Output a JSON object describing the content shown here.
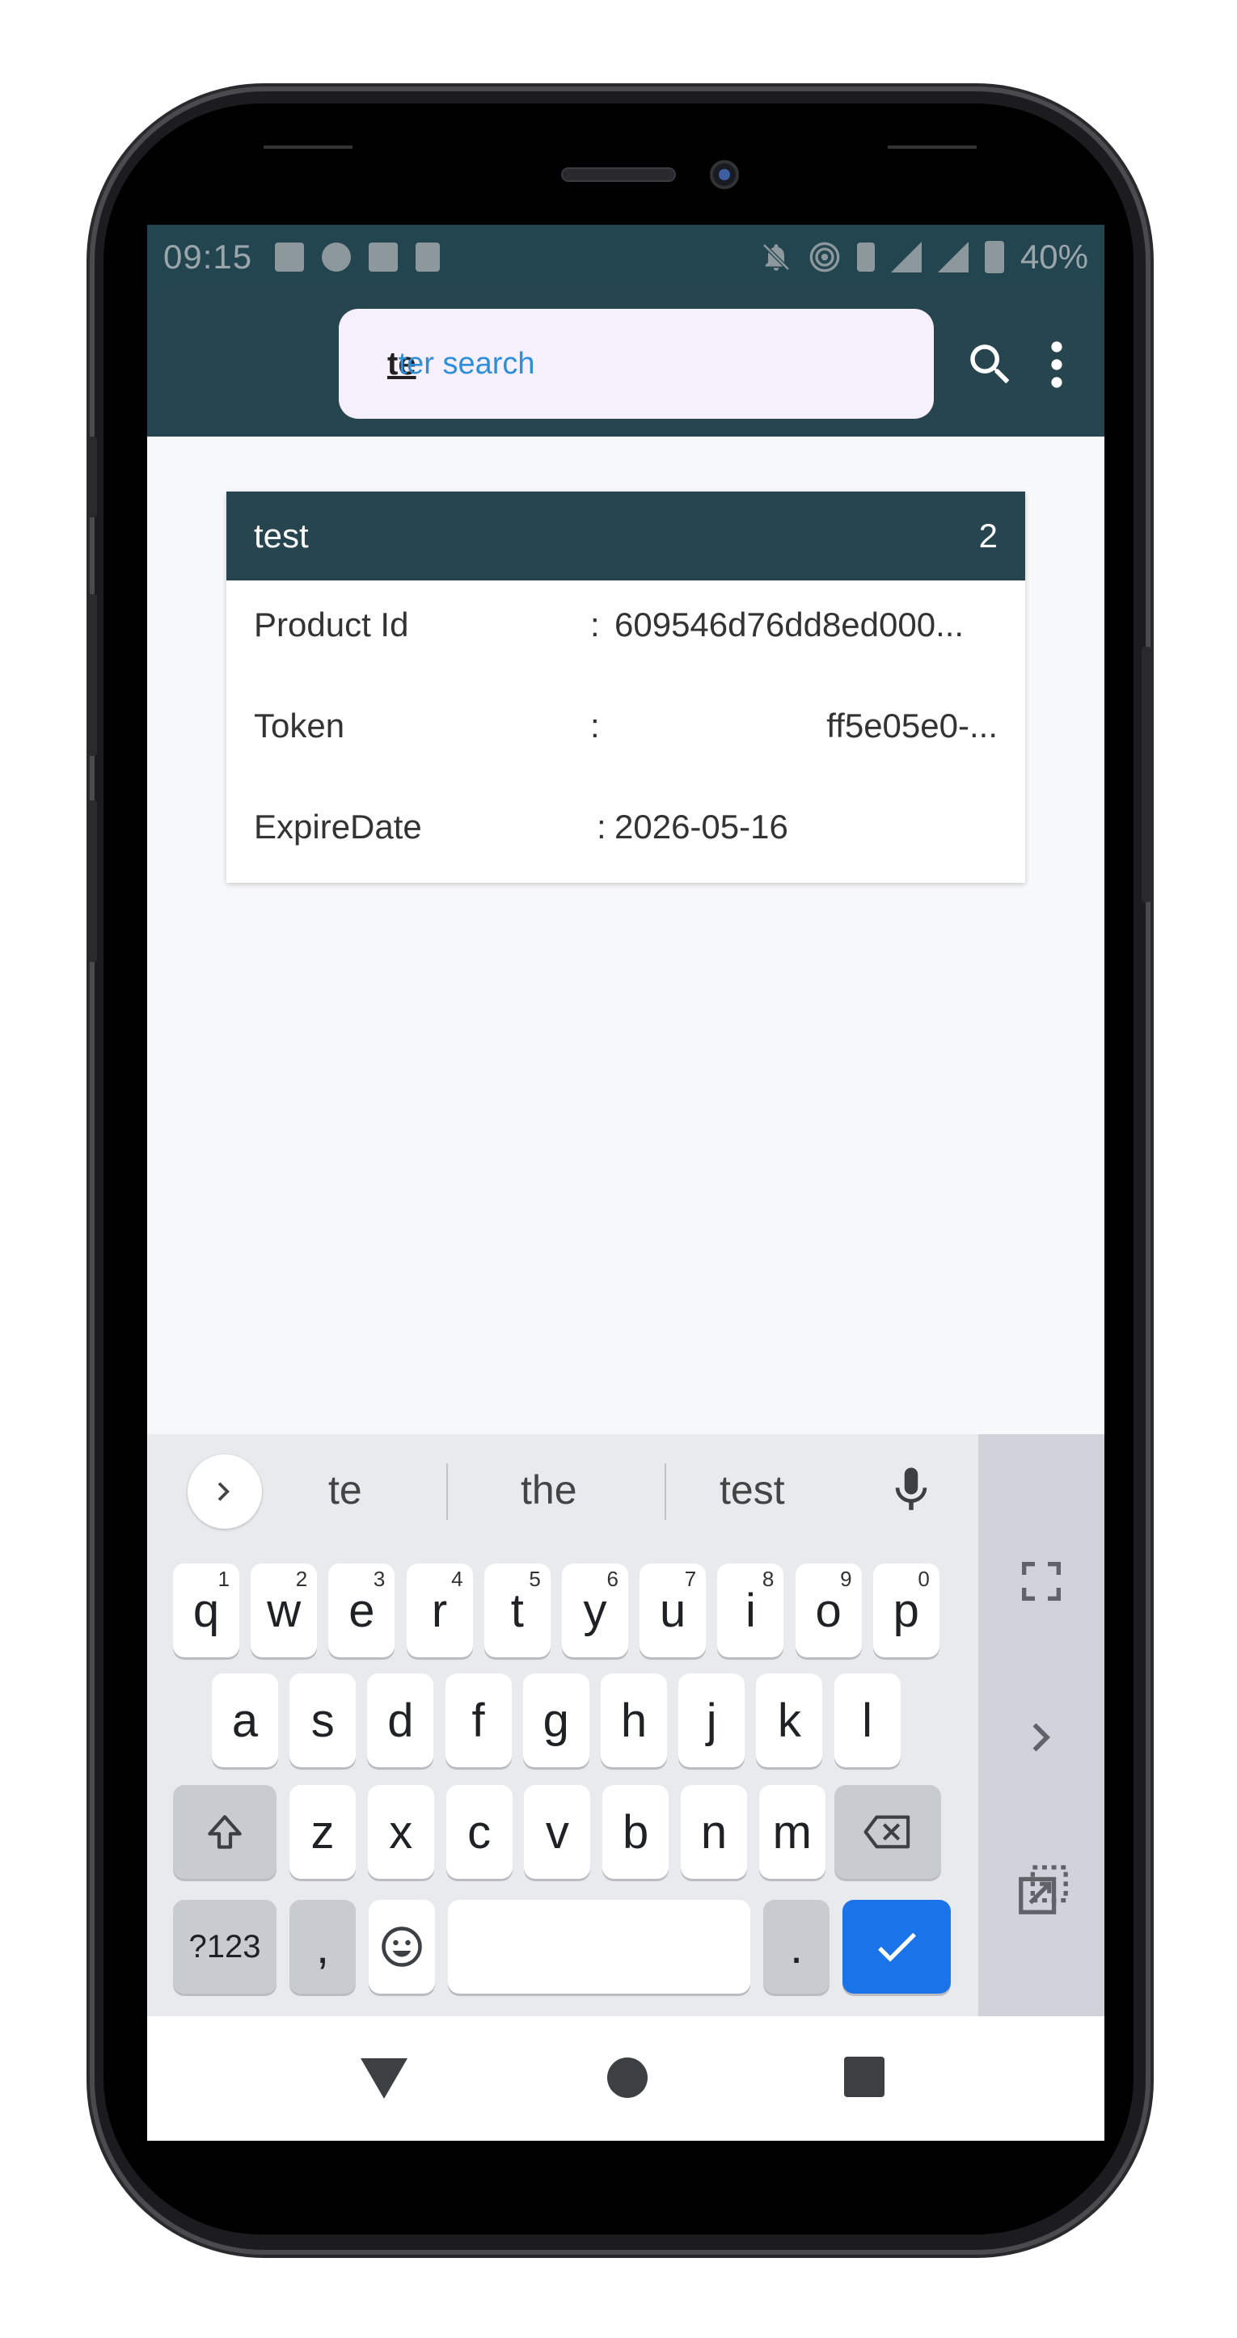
{
  "status_bar": {
    "time": "09:15",
    "battery": "40%",
    "icons": [
      "image-icon",
      "chat-bubble-icon",
      "mail-icon",
      "lock-icon",
      "notifications-off-icon",
      "hotspot-icon",
      "network-h-icon",
      "signal-icon",
      "signal-icon",
      "battery-icon"
    ]
  },
  "app_bar": {
    "search_typed": "te",
    "search_placeholder": "Enter search",
    "search_placeholder_visible": "ter search",
    "icons": [
      "search-icon",
      "more-vert-icon"
    ]
  },
  "card": {
    "title": "test",
    "count": "2",
    "rows": [
      {
        "label": "Product Id",
        "colon": ":",
        "value": "609546d76dd8ed000..."
      },
      {
        "label": "Token",
        "colon": ":",
        "value": "ff5e05e0-..."
      },
      {
        "label": "ExpireDate",
        "colon": ":",
        "value": "2026-05-16"
      }
    ]
  },
  "keyboard": {
    "suggestions": [
      "te",
      "the",
      "test"
    ],
    "row1": [
      {
        "k": "q",
        "h": "1"
      },
      {
        "k": "w",
        "h": "2"
      },
      {
        "k": "e",
        "h": "3"
      },
      {
        "k": "r",
        "h": "4"
      },
      {
        "k": "t",
        "h": "5"
      },
      {
        "k": "y",
        "h": "6"
      },
      {
        "k": "u",
        "h": "7"
      },
      {
        "k": "i",
        "h": "8"
      },
      {
        "k": "o",
        "h": "9"
      },
      {
        "k": "p",
        "h": "0"
      }
    ],
    "row2": [
      "a",
      "s",
      "d",
      "f",
      "g",
      "h",
      "j",
      "k",
      "l"
    ],
    "row3": [
      "z",
      "x",
      "c",
      "v",
      "b",
      "n",
      "m"
    ],
    "symbols_label": "?123",
    "comma": ",",
    "period": "."
  },
  "colors": {
    "app_bar": "#27454f",
    "status_bar": "#234550",
    "accent_blue": "#1a73e8",
    "placeholder_blue": "#2e8fd8"
  }
}
